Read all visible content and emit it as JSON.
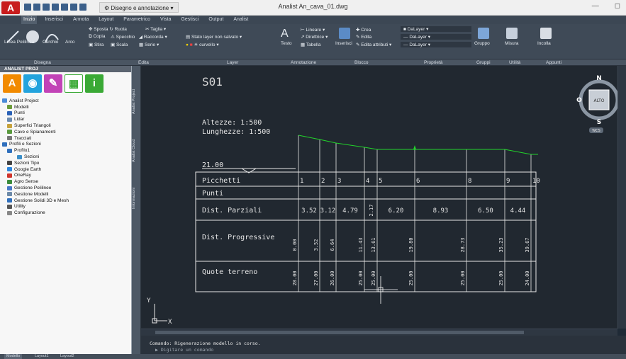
{
  "quick_access": {
    "workspace": "Disegno e annotazione"
  },
  "window": {
    "title": "Analist  An_cava_01.dwg",
    "minimize": "—",
    "restore": "◻"
  },
  "tabs": [
    "Inizio",
    "Inserisci",
    "Annota",
    "Layout",
    "Parametrico",
    "Vista",
    "Gestisci",
    "Output",
    "Analist"
  ],
  "ribbon": {
    "draw": {
      "polyline": "Linea Polilinea",
      "circle": "Cerchio",
      "arc": "Arco"
    },
    "modify": {
      "move": "Sposta",
      "rotate": "Ruota",
      "trim": "Taglia",
      "copy": "Copia",
      "mirror": "Specchio",
      "fillet": "Raccorda",
      "stretch": "Stira",
      "scale": "Scala",
      "array": "Serie"
    },
    "layer": {
      "state": "Stato layer non salvato",
      "current": "curvello"
    },
    "annotation": {
      "text": "Testo",
      "linear": "Lineare",
      "leader": "Direttrice",
      "table": "Tabella"
    },
    "block": {
      "insert": "Inserisci",
      "create": "Crea",
      "edit": "Edita",
      "edit_attr": "Edita attributi"
    },
    "properties": {
      "bylayer1": "DaLayer",
      "bylayer2": "DaLayer",
      "bylayer3": "DaLayer"
    },
    "groups": {
      "group": "Gruppo"
    },
    "utilities": {
      "measure": "Misura"
    },
    "clipboard": {
      "paste": "Incolla"
    }
  },
  "panels": [
    "Disegna",
    "Edita",
    "Layer",
    "Annotazione",
    "Blocco",
    "Proprietà",
    "Gruppi",
    "Utilità",
    "Appunti"
  ],
  "left_panel": {
    "title": "ANALIST PROJ",
    "big_icons": [
      {
        "label": "A",
        "color": "#f28a00"
      },
      {
        "label": "◉",
        "color": "#23a3dd"
      },
      {
        "label": "✎",
        "color": "#c243b7"
      },
      {
        "label": "▦",
        "color": "#ffffff"
      },
      {
        "label": "i",
        "color": "#3aa935"
      }
    ],
    "tree": [
      {
        "label": "Analist Project",
        "indent": 0,
        "color": "#4a8bd8"
      },
      {
        "label": "Modelli",
        "indent": 1,
        "color": "#6c9c3a"
      },
      {
        "label": "Punti",
        "indent": 1,
        "color": "#2a61b7"
      },
      {
        "label": "Lidar",
        "indent": 1,
        "color": "#6b8bb0"
      },
      {
        "label": "Superfici Triangoli",
        "indent": 1,
        "color": "#c7a23b"
      },
      {
        "label": "Cave e Spianamenti",
        "indent": 1,
        "color": "#5a9a3e"
      },
      {
        "label": "Tracciati",
        "indent": 1,
        "color": "#777777"
      },
      {
        "label": "Profili e Sezioni",
        "indent": 0,
        "color": "#2f6fbd"
      },
      {
        "label": "Profilo1",
        "indent": 1,
        "color": "#2f6fbd"
      },
      {
        "label": "Sezioni",
        "indent": 3,
        "color": "#3a8ec9"
      },
      {
        "label": "Sezioni Tipo",
        "indent": 1,
        "color": "#444444"
      },
      {
        "label": "Google Earth",
        "indent": 1,
        "color": "#2e86de"
      },
      {
        "label": "OneRay",
        "indent": 1,
        "color": "#d0342c"
      },
      {
        "label": "Agro Sense",
        "indent": 1,
        "color": "#3c8c3c"
      },
      {
        "label": "Gestione Polilinee",
        "indent": 1,
        "color": "#4878c8"
      },
      {
        "label": "Gestione Modelli",
        "indent": 1,
        "color": "#6d8aa8"
      },
      {
        "label": "Gestione Solidi 3D e Mesh",
        "indent": 1,
        "color": "#2f6fbd"
      },
      {
        "label": "Utility",
        "indent": 1,
        "color": "#555555"
      },
      {
        "label": "Configurazione",
        "indent": 1,
        "color": "#888888"
      }
    ]
  },
  "vertical_tabs": [
    "Analist Project",
    "Analist Cloud",
    "Informazioni"
  ],
  "drawing": {
    "section_title": "S01",
    "scale_h": "Altezze: 1:500",
    "scale_l": "Lunghezze: 1:500",
    "datum": "21.00",
    "rows": {
      "picchetti": "Picchetti",
      "punti": "Punti",
      "parziali": "Dist. Parziali",
      "progressive": "Dist. Progressive",
      "quote": "Quote terreno"
    },
    "stations": [
      "1",
      "2",
      "3",
      "4",
      "5",
      "6",
      "8",
      "9",
      "10"
    ],
    "partial_distances": [
      "3.52",
      "3.12",
      "4.79",
      "2.17",
      "6.20",
      "8.93",
      "6.50",
      "4.44"
    ],
    "progressive": [
      "0.00",
      "3.52",
      "6.64",
      "11.43",
      "13.61",
      "19.80",
      "28.73",
      "35.23",
      "39.67"
    ],
    "elevations": [
      "28.00",
      "27.00",
      "26.00",
      "25.00",
      "25.00",
      "25.00",
      "25.00",
      "25.00",
      "24.00"
    ],
    "ucs_y": "Y",
    "ucs_x": "X"
  },
  "viewcube": {
    "face": "ALTO",
    "n": "N",
    "s": "S",
    "e": "E",
    "w": "O",
    "wcs": "WCS"
  },
  "command": {
    "history": "Comando: Rigenerazione modello in corso.",
    "prompt": "Digitare un comando"
  },
  "layout_tabs": [
    "Modello",
    "Layout1",
    "Layout2"
  ]
}
